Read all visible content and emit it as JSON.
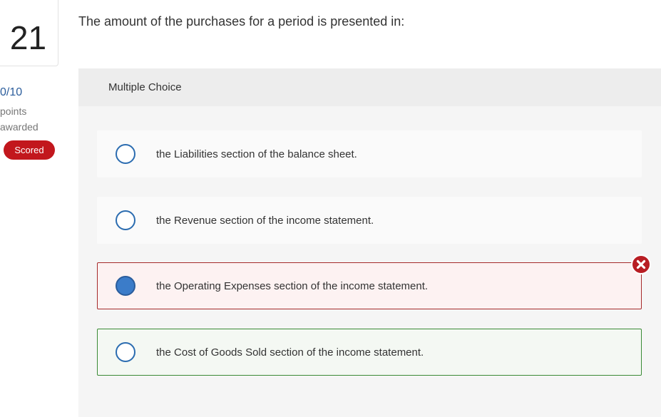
{
  "question": {
    "number": "21",
    "text": "The amount of the purchases for a period is presented in:"
  },
  "score": {
    "value": "0/10",
    "unit_line1": "points",
    "unit_line2": "awarded",
    "badge": "Scored"
  },
  "answer_panel": {
    "type_label": "Multiple Choice",
    "options": [
      {
        "label": "the Liabilities section of the balance sheet.",
        "selected": false,
        "status": "none"
      },
      {
        "label": "the Revenue section of the income statement.",
        "selected": false,
        "status": "none"
      },
      {
        "label": "the Operating Expenses section of the income statement.",
        "selected": true,
        "status": "incorrect"
      },
      {
        "label": "the Cost of Goods Sold section of the income statement.",
        "selected": false,
        "status": "correct"
      }
    ]
  },
  "colors": {
    "accent": "#2b5d9c",
    "scored_badge": "#c2171d",
    "incorrect_border": "#a52a2a",
    "correct_border": "#3a8a35"
  },
  "icons": {
    "incorrect_marker": "x-circle-icon"
  }
}
